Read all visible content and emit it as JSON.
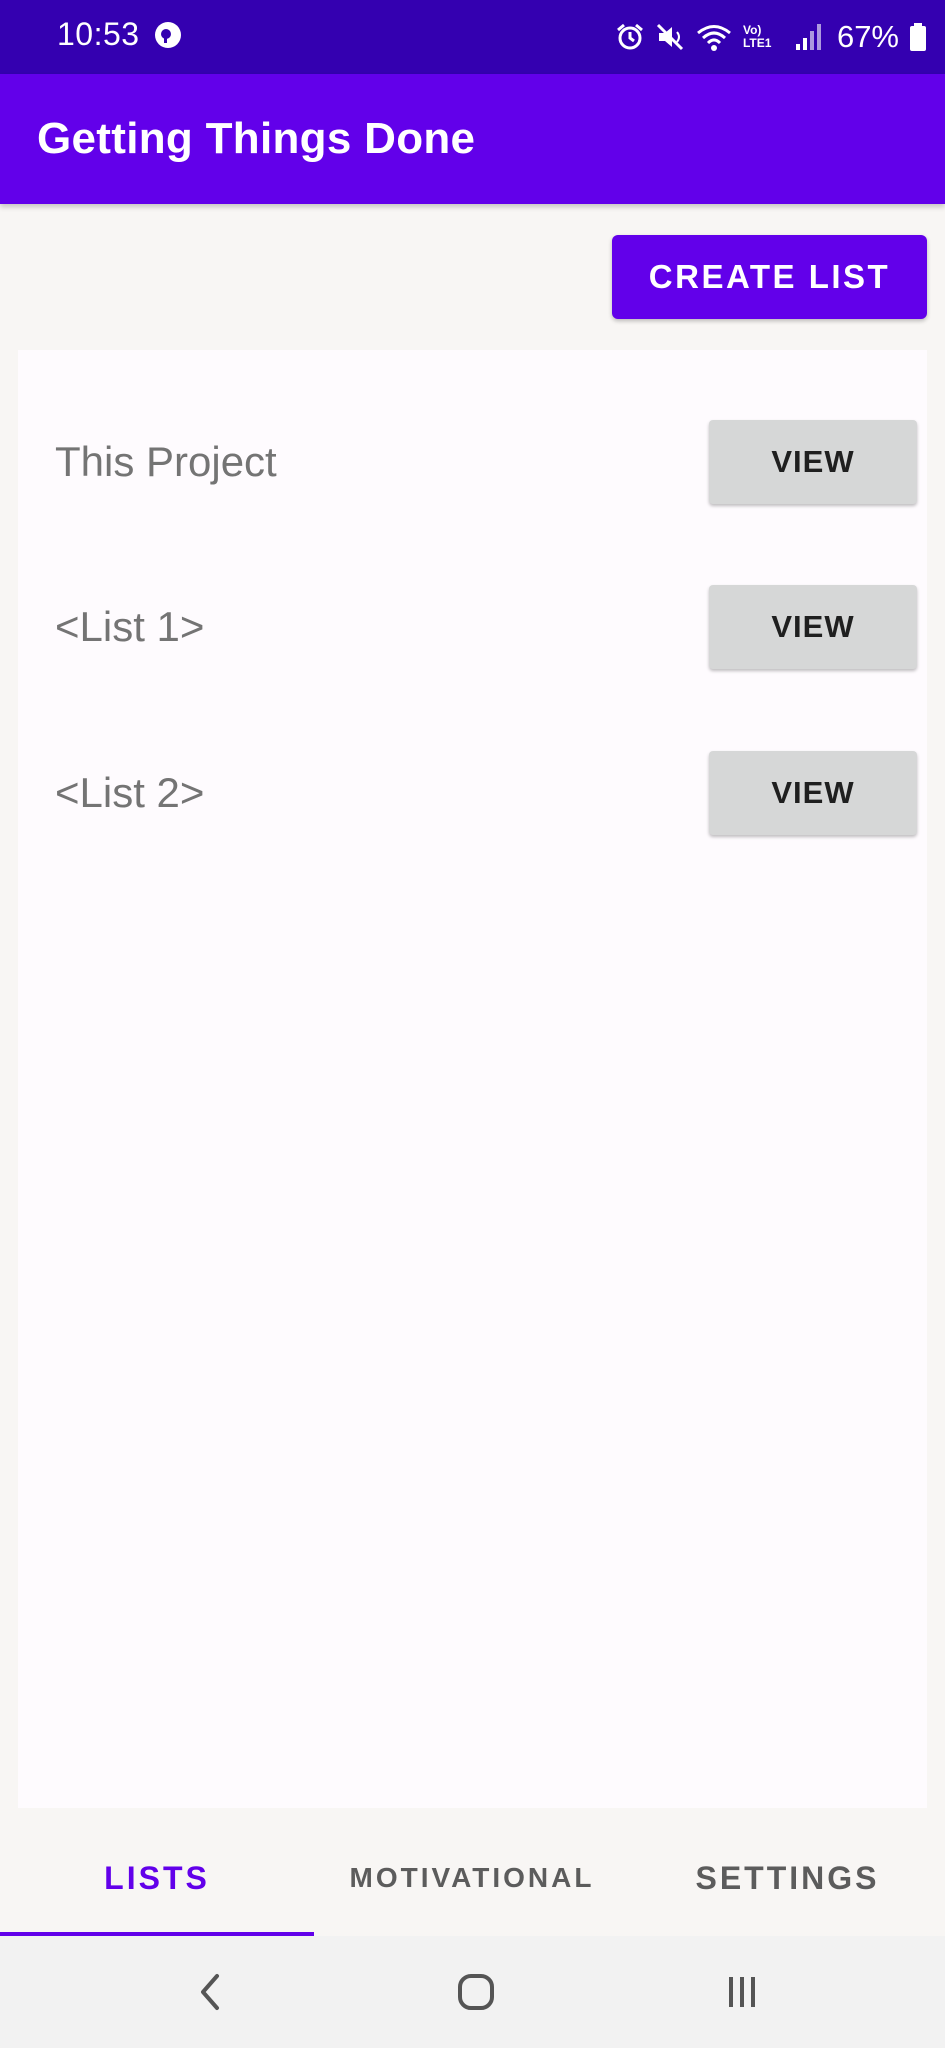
{
  "status_bar": {
    "time": "10:53",
    "battery": "67%",
    "network_label": "Vo) LTE1"
  },
  "app_bar": {
    "title": "Getting Things Done"
  },
  "actions": {
    "create_list_label": "CREATE LIST"
  },
  "lists": [
    {
      "name": "This Project",
      "button_label": "VIEW"
    },
    {
      "name": "<List 1>",
      "button_label": "VIEW"
    },
    {
      "name": "<List 2>",
      "button_label": "VIEW"
    }
  ],
  "tabs": [
    {
      "label": "LISTS",
      "selected": true
    },
    {
      "label": "MOTIVATIONAL",
      "selected": false
    },
    {
      "label": "SETTINGS",
      "selected": false
    }
  ],
  "colors": {
    "primary": "#6200ea",
    "status_bar": "#3400b0",
    "view_button": "#d6d7d7"
  },
  "icons": [
    "notification-app-icon",
    "alarm-icon",
    "mute-icon",
    "wifi-icon",
    "signal-icon",
    "battery-icon",
    "back-icon",
    "home-icon",
    "recents-icon"
  ]
}
